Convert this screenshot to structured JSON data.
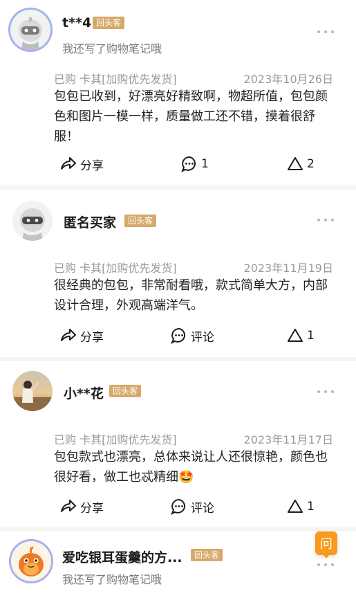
{
  "reviews": [
    {
      "username": "t**4",
      "badge": "回头客",
      "note": "我还写了购物笔记哦",
      "spec": "已购 卡其[加购优先发货]",
      "date": "2023年10月26日",
      "text": "包包已收到，好漂亮好精致啊，物超所值，包包颜色和图片一模一样，质量做工还不错，摸着很舒服！",
      "share_label": "分享",
      "comment_label": "1",
      "like_count": "2"
    },
    {
      "username": "匿名买家",
      "badge": "回头客",
      "spec": "已购 卡其[加购优先发货]",
      "date": "2023年11月19日",
      "text": "很经典的包包，非常耐看哦，款式简单大方，内部设计合理，外观高端洋气。",
      "share_label": "分享",
      "comment_label": "评论",
      "like_count": "1"
    },
    {
      "username": "小**花",
      "badge": "回头客",
      "spec": "已购 卡其[加购优先发货]",
      "date": "2023年11月17日",
      "text": "包包款式也漂亮，总体来说让人还很惊艳，颜色也很好看，做工也忒精细🤩",
      "share_label": "分享",
      "comment_label": "评论",
      "like_count": "1"
    },
    {
      "username": "爱吃银耳蛋羹的方...",
      "badge": "回头客",
      "note": "我还写了购物笔记哦"
    }
  ],
  "ask_button_label": "问",
  "colors": {
    "badge": "#d6a96b",
    "ask": "#f79a1e",
    "background": "#f4f4f2"
  }
}
